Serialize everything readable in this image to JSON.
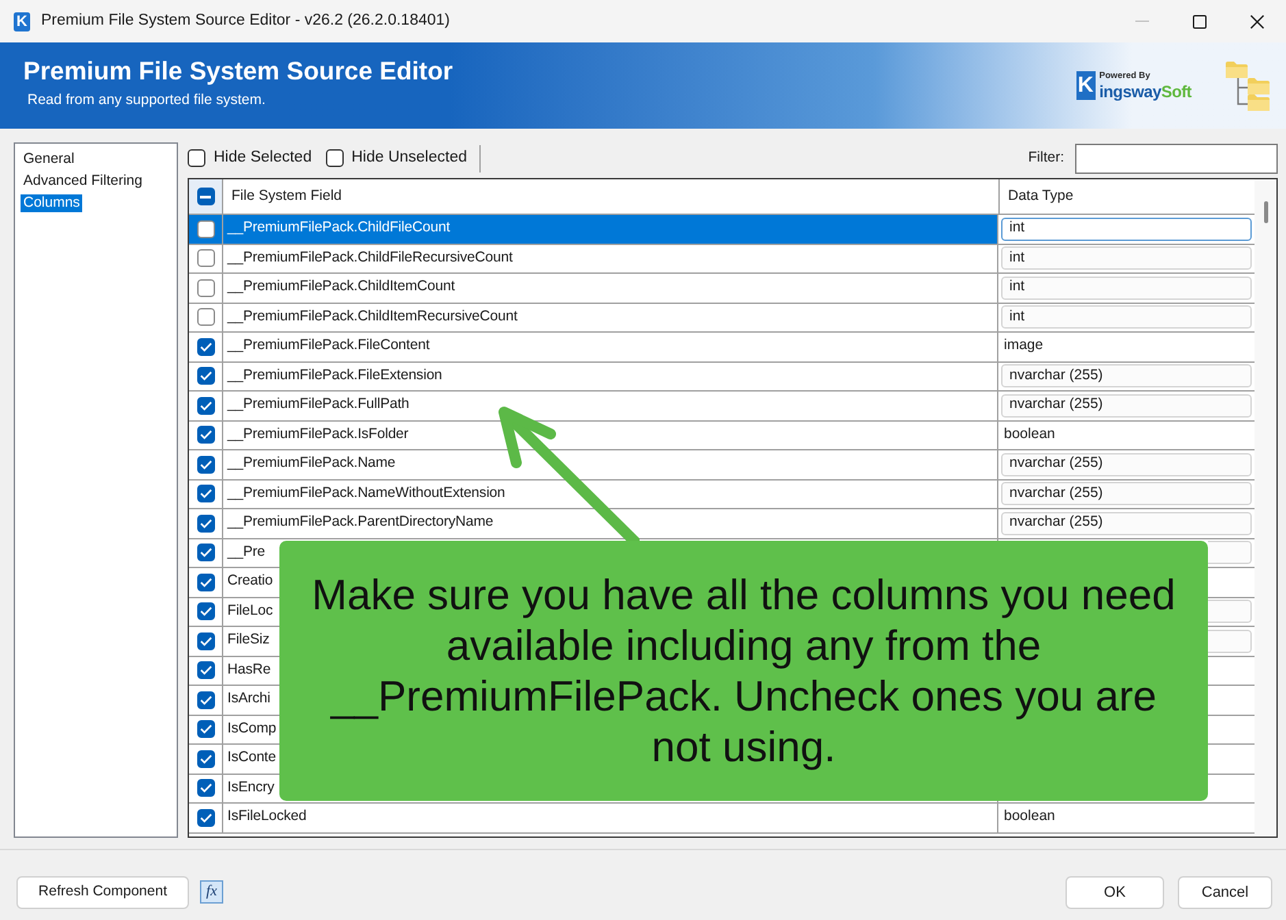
{
  "window": {
    "app_icon": "K",
    "title": "Premium File System Source Editor - v26.2 (26.2.0.18401)",
    "controls": [
      {
        "kind": "minimize",
        "disabled": true
      },
      {
        "kind": "maximize",
        "disabled": false
      },
      {
        "kind": "close",
        "disabled": false
      }
    ]
  },
  "header": {
    "title": "Premium File System Source Editor",
    "subtitle": "Read from any supported file system.",
    "logo": {
      "tagline": "Powered By",
      "initial": "K",
      "name": "ingsway",
      "accent": "Soft"
    }
  },
  "sidebar": {
    "items": [
      {
        "label": "General",
        "selected": false
      },
      {
        "label": "Advanced Filtering",
        "selected": false
      },
      {
        "label": "Columns",
        "selected": true
      }
    ]
  },
  "toolbar": {
    "toggles": [
      {
        "label": "Hide Selected",
        "checked": false
      },
      {
        "label": "Hide Unselected",
        "checked": false
      }
    ],
    "filter": {
      "label": "Filter:"
    }
  },
  "table": {
    "select_all": {
      "indeterminate": true
    },
    "columns": [
      "File System Field",
      "Data Type"
    ],
    "rows": [
      {
        "field": "__PremiumFilePack.ChildFileCount",
        "checked": false,
        "selected": true,
        "data_type": {
          "kind": "input",
          "value": "int"
        }
      },
      {
        "field": "__PremiumFilePack.ChildFileRecursiveCount",
        "checked": false,
        "selected": false,
        "data_type": {
          "kind": "input",
          "value": "int"
        }
      },
      {
        "field": "__PremiumFilePack.ChildItemCount",
        "checked": false,
        "selected": false,
        "data_type": {
          "kind": "input",
          "value": "int"
        }
      },
      {
        "field": "__PremiumFilePack.ChildItemRecursiveCount",
        "checked": false,
        "selected": false,
        "data_type": {
          "kind": "input",
          "value": "int"
        }
      },
      {
        "field": "__PremiumFilePack.FileContent",
        "checked": true,
        "selected": false,
        "data_type": {
          "kind": "text",
          "value": "image"
        }
      },
      {
        "field": "__PremiumFilePack.FileExtension",
        "checked": true,
        "selected": false,
        "data_type": {
          "kind": "input",
          "value": "nvarchar (255)"
        }
      },
      {
        "field": "__PremiumFilePack.FullPath",
        "checked": true,
        "selected": false,
        "data_type": {
          "kind": "input",
          "value": "nvarchar (255)"
        }
      },
      {
        "field": "__PremiumFilePack.IsFolder",
        "checked": true,
        "selected": false,
        "data_type": {
          "kind": "text",
          "value": "boolean"
        }
      },
      {
        "field": "__PremiumFilePack.Name",
        "checked": true,
        "selected": false,
        "data_type": {
          "kind": "input",
          "value": "nvarchar (255)"
        }
      },
      {
        "field": "__PremiumFilePack.NameWithoutExtension",
        "checked": true,
        "selected": false,
        "data_type": {
          "kind": "input",
          "value": "nvarchar (255)"
        }
      },
      {
        "field": "__PremiumFilePack.ParentDirectoryName",
        "checked": true,
        "selected": false,
        "data_type": {
          "kind": "input",
          "value": "nvarchar (255)"
        }
      },
      {
        "field": "__Pre",
        "checked": true,
        "selected": false,
        "data_type": {
          "kind": "input"
        }
      },
      {
        "field": "Creatio",
        "checked": true,
        "selected": false,
        "data_type": {
          "kind": "text"
        }
      },
      {
        "field": "FileLoc",
        "checked": true,
        "selected": false,
        "data_type": {
          "kind": "input"
        }
      },
      {
        "field": "FileSiz",
        "checked": true,
        "selected": false,
        "data_type": {
          "kind": "input"
        }
      },
      {
        "field": "HasRe",
        "checked": true,
        "selected": false,
        "data_type": {
          "kind": "text"
        }
      },
      {
        "field": "IsArchi",
        "checked": true,
        "selected": false,
        "data_type": {
          "kind": "text"
        }
      },
      {
        "field": "IsComp",
        "checked": true,
        "selected": false,
        "data_type": {
          "kind": "text"
        }
      },
      {
        "field": "IsConte",
        "checked": true,
        "selected": false,
        "data_type": {
          "kind": "text"
        }
      },
      {
        "field": "IsEncry",
        "checked": true,
        "selected": false,
        "data_type": {
          "kind": "text"
        }
      },
      {
        "field": "IsFileLocked",
        "checked": true,
        "selected": false,
        "data_type": {
          "kind": "text",
          "value": "boolean"
        }
      }
    ]
  },
  "callout": {
    "text": "Make sure you have all the columns you need available including any from the __PremiumFilePack. Uncheck ones you are not using."
  },
  "footer": {
    "refresh_button": "Refresh Component",
    "expression_button": "fx",
    "buttons": [
      "OK",
      "Cancel"
    ]
  }
}
